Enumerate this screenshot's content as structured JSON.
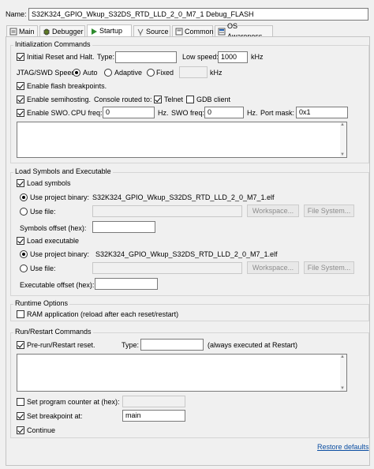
{
  "header": {
    "name_label": "Name:",
    "name_value": "S32K324_GPIO_Wkup_S32DS_RTD_LLD_2_0_M7_1 Debug_FLASH"
  },
  "tabs": [
    {
      "label": "Main",
      "icon": "main-tab-icon"
    },
    {
      "label": "Debugger",
      "icon": "debugger-tab-icon"
    },
    {
      "label": "Startup",
      "icon": "startup-tab-icon",
      "active": true
    },
    {
      "label": "Source",
      "icon": "source-tab-icon"
    },
    {
      "label": "Common",
      "icon": "common-tab-icon"
    },
    {
      "label": "OS Awareness",
      "icon": "os-awareness-tab-icon"
    }
  ],
  "init": {
    "title": "Initialization Commands",
    "initial_reset_label": "Initial Reset and Halt.",
    "type_label": "Type:",
    "type_value": "",
    "low_speed_label": "Low speed:",
    "low_speed_value": "1000",
    "low_speed_unit": "kHz",
    "jtag_label": "JTAG/SWD Speed:",
    "auto_label": "Auto",
    "adaptive_label": "Adaptive",
    "fixed_label": "Fixed",
    "fixed_value": "",
    "fixed_unit": "kHz",
    "flash_bp_label": "Enable flash breakpoints.",
    "semihosting_label": "Enable semihosting.",
    "console_routed_label": "Console routed to:",
    "telnet_label": "Telnet",
    "gdb_client_label": "GDB client",
    "swo_label": "Enable SWO.",
    "cpu_freq_label": "CPU freq:",
    "cpu_freq_value": "0",
    "cpu_freq_unit": "Hz.",
    "swo_freq_label": "SWO freq:",
    "swo_freq_value": "0",
    "swo_freq_unit": "Hz.",
    "port_mask_label": "Port mask:",
    "port_mask_value": "0x1",
    "commands_text": ""
  },
  "load": {
    "title": "Load Symbols and Executable",
    "load_symbols_label": "Load symbols",
    "use_project_binary_label": "Use project binary:",
    "symbols_binary": "S32K324_GPIO_Wkup_S32DS_RTD_LLD_2_0_M7_1.elf",
    "use_file_label": "Use file:",
    "symbols_file_value": "",
    "workspace_label": "Workspace...",
    "file_system_label": "File System...",
    "symbols_offset_label": "Symbols offset (hex):",
    "symbols_offset_value": "",
    "load_executable_label": "Load executable",
    "exec_binary": "S32K324_GPIO_Wkup_S32DS_RTD_LLD_2_0_M7_1.elf",
    "exec_file_value": "",
    "exec_offset_label": "Executable offset (hex):",
    "exec_offset_value": ""
  },
  "runtime": {
    "title": "Runtime Options",
    "ram_app_label": "RAM application (reload after each reset/restart)"
  },
  "run": {
    "title": "Run/Restart Commands",
    "prerun_label": "Pre-run/Restart reset.",
    "type_label": "Type:",
    "type_value": "",
    "always_note": "(always executed at Restart)",
    "commands_text": "",
    "set_pc_label": "Set program counter at (hex):",
    "set_pc_value": "",
    "set_bp_label": "Set breakpoint at:",
    "set_bp_value": "main",
    "continue_label": "Continue"
  },
  "footer": {
    "restore_defaults_label": "Restore defaults"
  },
  "colors": {
    "accent": "#0b4ea2",
    "startup_icon": "#2e8b2e"
  }
}
